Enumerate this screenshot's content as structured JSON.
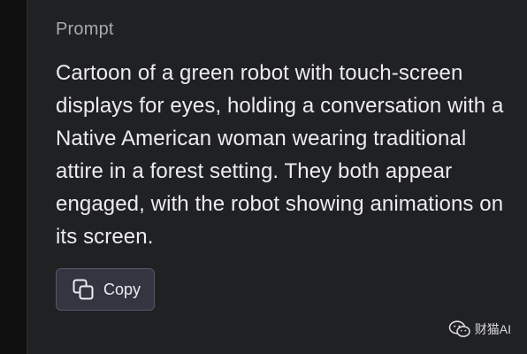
{
  "prompt_panel": {
    "label": "Prompt",
    "text": "Cartoon of a green robot with touch-screen\ndisplays for eyes, holding a conversation with a\nNative American woman wearing traditional\nattire in a forest setting. They both appear\nengaged, with the robot showing animations on\nits screen.",
    "copy_button": {
      "label": "Copy",
      "icon": "copy-icon"
    }
  },
  "watermark": {
    "icon": "wechat-icon",
    "text": "财猫AI"
  },
  "colors": {
    "background": "#202123",
    "left_edge": "#0f0f10",
    "label": "#a8a9ad",
    "text": "#ececf1",
    "button_bg": "#343541",
    "button_border": "#565869"
  }
}
